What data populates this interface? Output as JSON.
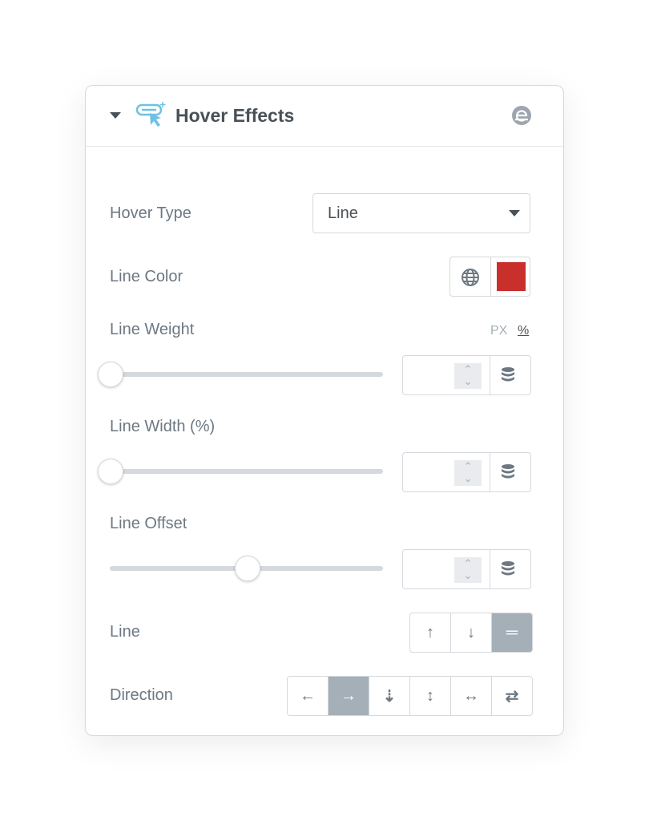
{
  "section": {
    "title": "Hover Effects",
    "icon": "hover-cursor-icon",
    "collapse_icon": "caret-down-icon",
    "brand_icon": "elementor-e-icon"
  },
  "hover_type": {
    "label": "Hover Type",
    "value": "Line"
  },
  "line_color": {
    "label": "Line Color",
    "color": "#c9302c",
    "global_icon": "globe-icon"
  },
  "line_weight": {
    "label": "Line Weight",
    "units": [
      "PX",
      "%"
    ],
    "active_unit": "%",
    "value": "",
    "slider_percent": 0
  },
  "line_width": {
    "label": "Line Width (%)",
    "value": "",
    "slider_percent": 0
  },
  "line_offset": {
    "label": "Line Offset",
    "value": "",
    "slider_percent": 50
  },
  "line": {
    "label": "Line",
    "options": [
      {
        "icon": "arrow-up-icon",
        "glyph": "↑"
      },
      {
        "icon": "arrow-down-icon",
        "glyph": "↓"
      },
      {
        "icon": "equals-icon",
        "glyph": "═"
      }
    ],
    "selected": 2
  },
  "direction": {
    "label": "Direction",
    "options": [
      {
        "icon": "arrow-left-icon",
        "glyph": "←"
      },
      {
        "icon": "arrow-right-icon",
        "glyph": "→"
      },
      {
        "icon": "arrows-inward-vertical-icon",
        "glyph": "⇣"
      },
      {
        "icon": "arrows-vertical-icon",
        "glyph": "↕"
      },
      {
        "icon": "arrows-horizontal-icon",
        "glyph": "↔"
      },
      {
        "icon": "arrows-swap-icon",
        "glyph": "⇄"
      }
    ],
    "selected": 1
  }
}
